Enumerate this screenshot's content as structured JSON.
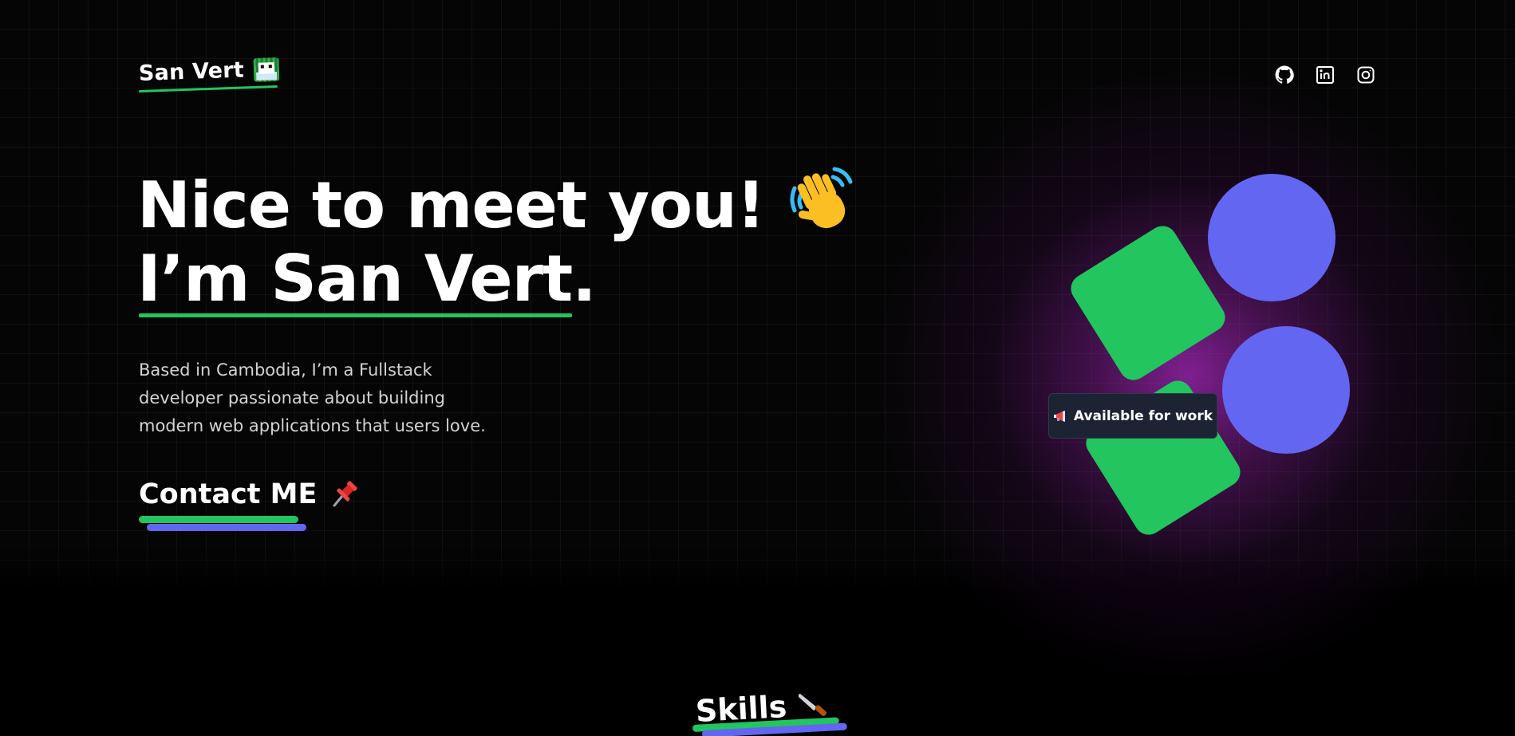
{
  "brand": {
    "name": "San Vert",
    "avatar_icon": "pixel-avatar-icon"
  },
  "socials": [
    {
      "name": "github",
      "icon": "github-icon"
    },
    {
      "name": "linkedin",
      "icon": "linkedin-icon"
    },
    {
      "name": "instagram",
      "icon": "instagram-icon"
    }
  ],
  "hero": {
    "line1": "Nice to meet you!",
    "line1_icon": "waving-hand-icon",
    "line2": "I’m San Vert.",
    "bio": "Based in Cambodia, I’m a Fullstack developer passionate about building modern web applications that users love.",
    "cta_label": "Contact ME",
    "cta_icon": "pushpin-icon"
  },
  "badge": {
    "label": "Available for work",
    "icon": "megaphone-icon"
  },
  "skills": {
    "title": "Skills",
    "icon": "knife-icon"
  },
  "colors": {
    "background": "#000000",
    "accent_green": "#22c55e",
    "accent_indigo": "#6366f1",
    "glow_purple": "#a828be",
    "badge_bg": "#1c2333"
  }
}
